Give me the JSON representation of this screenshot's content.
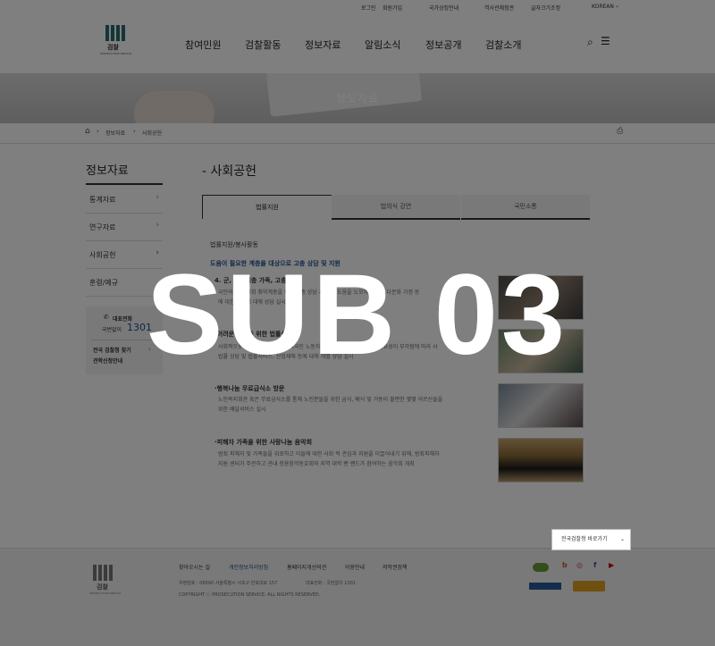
{
  "utility": {
    "login": "로그인",
    "join": "회원가입",
    "gov_guide": "국가상징안내",
    "history": "역사관체험관",
    "font_size": "글자크기조정",
    "lang": "KOREAN"
  },
  "logo": {
    "name": "검찰",
    "sub": "PROSECUTION SERVICE"
  },
  "nav": [
    "참여민원",
    "검찰활동",
    "정보자료",
    "알림소식",
    "정보공개",
    "검찰소개"
  ],
  "banner": {
    "title": "정보자료"
  },
  "breadcrumb": [
    "정보자료",
    "사회공헌"
  ],
  "sidebar": {
    "title": "정보자료",
    "items": [
      "통계자료",
      "연구자료",
      "사회공헌",
      "훈령/예규"
    ],
    "box": {
      "phone_label": "대표전화",
      "phone_prefix": "국번없이",
      "phone_number": "1301",
      "link": "전국 검찰청 찾기",
      "link2": "견학신청안내"
    }
  },
  "content": {
    "title": "- 사회공헌",
    "tabs": [
      "법률지원",
      "법의식 강연",
      "국민소통"
    ],
    "section": "법률지원/봉사활동",
    "lead": "도움이 필요한 계층을 대상으로 고충 상담 및 지원",
    "items": [
      {
        "heading": "4. 군, 취약계층 가족, 고충 상담",
        "lines": [
          "국민의 우리 사회 취약계층을 위한 고충 상담 지원 등 도움을 도모하기 위해,다문화 가정 등",
          "에 대한 고충에 대해 상담 실시"
        ]
      },
      {
        "heading": "·어려운 이웃을 위한 법률상담",
        "lines": [
          "사회적으로 배려 필요한 계층의 외국인 노동자 등에 대한 배려와 관심이 필요성이 부각됨에 따라 사",
          "법률 상담 및 법률서비스, 산업재해 등에 대해 개별 상담 실시"
        ]
      },
      {
        "heading": "·행복나눔 무료급식소 방문",
        "lines": [
          "노인복지회관 혹은 무료급식소를 통해 노인분들을 위한 급식, 배식 및 거동이 불편한 몇몇 어르신들을",
          "위한 배달서비스 실시"
        ]
      },
      {
        "heading": "·피해자 가족을 위한 사랑나눔 음악회",
        "lines": [
          "범죄 피해자 및 가족들을 위로하고 이들에 대한 사회 적 관심과 지원을 이끌어내기 위해, 범죄피해자",
          "지원 센터가 주관하고 관내 청용음악동호회와 지역 대학 밴 밴드가 참여하는 음악회 개최"
        ]
      }
    ]
  },
  "footer": {
    "links": [
      "찾아오시는 길",
      "개인정보처리방침",
      "홈페이지개선의견",
      "이용안내",
      "저작권정책"
    ],
    "select": "전국검찰청 바로가기",
    "address": "우편번호 : 06590 서울특별시 서초구 반포대로 157",
    "phone": "대표전화 : 국번없이 1301",
    "copyright": "COPYRIGHT ⓒ PROSECUTION SERVICE. ALL RIGHTS RESERVED."
  },
  "overlay_text": "SUB 03",
  "colors": {
    "accent": "#1a4f8f",
    "overlay": "rgba(0,0,0,0.5)"
  }
}
